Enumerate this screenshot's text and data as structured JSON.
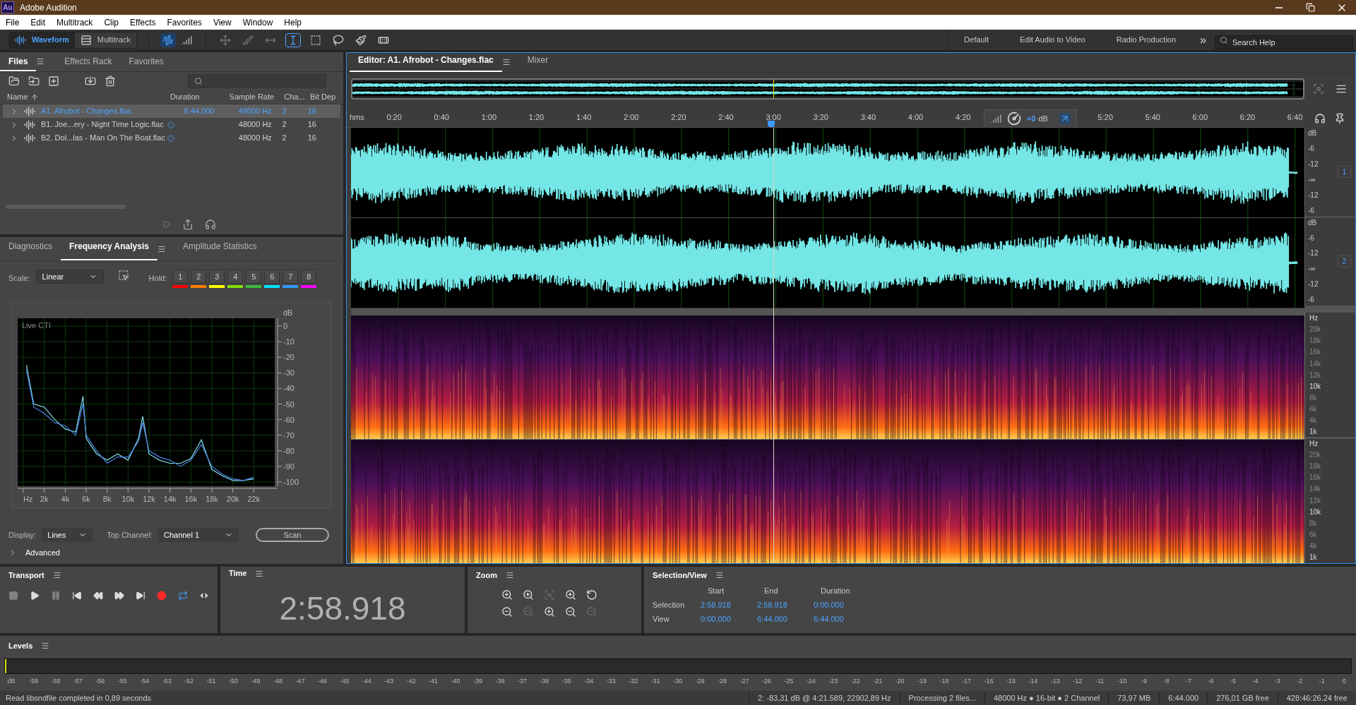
{
  "window": {
    "app_icon": "Au",
    "title": "Adobe Audition"
  },
  "menu": [
    "File",
    "Edit",
    "Multitrack",
    "Clip",
    "Effects",
    "Favorites",
    "View",
    "Window",
    "Help"
  ],
  "toolbar": {
    "modes": [
      {
        "label": "Waveform",
        "kind": "waveform",
        "selected": true
      },
      {
        "label": "Multitrack",
        "kind": "multitrack",
        "selected": false
      }
    ],
    "views": [
      {
        "kind": "waveform",
        "selected": true
      },
      {
        "kind": "spectral",
        "selected": false
      }
    ],
    "tools": [
      {
        "kind": "move",
        "selected": false,
        "disabled": true
      },
      {
        "kind": "razor",
        "selected": false,
        "disabled": true
      },
      {
        "kind": "slip",
        "selected": false,
        "disabled": true
      },
      {
        "kind": "time",
        "selected": true,
        "disabled": false
      },
      {
        "kind": "marquee",
        "selected": false,
        "disabled": false
      },
      {
        "kind": "lasso",
        "selected": false,
        "disabled": false
      },
      {
        "kind": "brush",
        "selected": false,
        "disabled": false
      },
      {
        "kind": "heal",
        "selected": false,
        "disabled": false
      }
    ],
    "workspaces": [
      "Default",
      "Edit Audio to Video",
      "Radio Production"
    ],
    "more": "»",
    "search": {
      "placeholder": "Search Help"
    }
  },
  "files_panel": {
    "tabs": [
      {
        "label": "Files",
        "selected": true
      },
      {
        "label": "Effects Rack",
        "selected": false
      },
      {
        "label": "Favorites",
        "selected": false
      }
    ],
    "columns": [
      "Name",
      "Duration",
      "Sample Rate",
      "Cha...",
      "Bit Dep"
    ],
    "rows": [
      {
        "name": "A1. Afrobot - Changes.flac",
        "duration": "6:44.000",
        "sample_rate": "48000 Hz",
        "channels": "2",
        "bit_depth": "16",
        "selected": true,
        "loading": false
      },
      {
        "name": "B1. Joe...ery - Night Time Logic.flac",
        "sample_rate": "48000 Hz",
        "channels": "2",
        "bit_depth": "16",
        "selected": false,
        "loading": true
      },
      {
        "name": "B2. Dol...las - Man On The Boat.flac",
        "sample_rate": "48000 Hz",
        "channels": "2",
        "bit_depth": "16",
        "selected": false,
        "loading": true
      }
    ]
  },
  "analysis_panel": {
    "tabs": [
      {
        "label": "Diagnostics",
        "selected": false
      },
      {
        "label": "Frequency Analysis",
        "selected": true
      },
      {
        "label": "Amplitude Statistics",
        "selected": false
      }
    ],
    "scale_label": "Scale:",
    "scale_value": "Linear",
    "hold_label": "Hold:",
    "holds": [
      {
        "label": "1",
        "color": "#ff0000"
      },
      {
        "label": "2",
        "color": "#ff8000"
      },
      {
        "label": "3",
        "color": "#ffff00"
      },
      {
        "label": "4",
        "color": "#80e000"
      },
      {
        "label": "5",
        "color": "#3cb83c"
      },
      {
        "label": "6",
        "color": "#00e5ff"
      },
      {
        "label": "7",
        "color": "#3399ff"
      },
      {
        "label": "8",
        "color": "#ff00ff"
      }
    ],
    "chart_data": {
      "type": "line",
      "title": "Live CTI",
      "ylabel": "dB",
      "grid": true,
      "x": [
        300,
        1000,
        2000,
        3000,
        4000,
        5000,
        5700,
        6000,
        7000,
        8000,
        9000,
        10000,
        11000,
        11400,
        12000,
        13000,
        14000,
        15000,
        16000,
        17000,
        18000,
        19000,
        20000,
        21000,
        22000
      ],
      "series": [
        {
          "color": "#7fe0e8",
          "values": [
            -25,
            -50,
            -52,
            -60,
            -66,
            -68,
            -45,
            -72,
            -82,
            -86,
            -82,
            -86,
            -72,
            -58,
            -82,
            -86,
            -88,
            -88,
            -85,
            -73,
            -92,
            -96,
            -99,
            -99,
            -98
          ]
        },
        {
          "color": "#4a7fe0",
          "values": [
            -28,
            -52,
            -56,
            -62,
            -64,
            -70,
            -50,
            -70,
            -80,
            -88,
            -84,
            -84,
            -74,
            -62,
            -80,
            -84,
            -86,
            -90,
            -86,
            -76,
            -90,
            -95,
            -98,
            -99,
            -97
          ]
        }
      ],
      "xlim": [
        0,
        24000
      ],
      "ylim": [
        -100,
        5
      ],
      "xticks": [
        {
          "value": 0,
          "label": "Hz"
        },
        {
          "value": 2000,
          "label": "2k"
        },
        {
          "value": 4000,
          "label": "4k"
        },
        {
          "value": 6000,
          "label": "6k"
        },
        {
          "value": 8000,
          "label": "8k"
        },
        {
          "value": 10000,
          "label": "10k"
        },
        {
          "value": 12000,
          "label": "12k"
        },
        {
          "value": 14000,
          "label": "14k"
        },
        {
          "value": 16000,
          "label": "16k"
        },
        {
          "value": 18000,
          "label": "18k"
        },
        {
          "value": 20000,
          "label": "20k"
        },
        {
          "value": 22000,
          "label": "22k"
        }
      ],
      "yticks": [
        0,
        -10,
        -20,
        -30,
        -40,
        -50,
        -60,
        -70,
        -80,
        -90,
        -100
      ]
    },
    "display_label": "Display:",
    "display_value": "Lines",
    "top_channel_label": "Top Channel:",
    "top_channel_value": "Channel 1",
    "scan": "Scan",
    "advanced": {
      "label": "Advanced",
      "expanded": false
    }
  },
  "editor": {
    "tabs": [
      {
        "label": "Editor: A1. Afrobot - Changes.flac",
        "selected": true
      },
      {
        "label": "Mixer",
        "selected": false
      }
    ],
    "ruler": {
      "unit": "hms",
      "labels": [
        "0:20",
        "0:40",
        "1:00",
        "1:20",
        "1:40",
        "2:00",
        "2:20",
        "2:40",
        "3:00",
        "3:20",
        "3:40",
        "4:00",
        "4:20",
        "5:20",
        "5:40",
        "6:00",
        "6:20",
        "6:40"
      ]
    },
    "hud": {
      "gain": "+0",
      "unit": "dB"
    },
    "playhead": {
      "level": 0.443
    },
    "channels": [
      {
        "badge": "1",
        "scale": [
          "dB",
          "-6",
          "-12",
          "-∞",
          "-12",
          "-6"
        ]
      },
      {
        "badge": "2",
        "scale": [
          "dB",
          "-6",
          "-12",
          "-∞",
          "-12",
          "-6"
        ]
      }
    ],
    "spectral": [
      {
        "scale": [
          "Hz",
          "20k",
          "18k",
          "16k",
          "14k",
          "12k",
          "10k",
          "8k",
          "6k",
          "4k",
          "1k"
        ]
      },
      {
        "scale": [
          "Hz",
          "20k",
          "18k",
          "16k",
          "14k",
          "12k",
          "10k",
          "8k",
          "6k",
          "4k",
          "1k"
        ]
      }
    ]
  },
  "transport": {
    "title": "Transport",
    "buttons": [
      {
        "kind": "stop",
        "disabled": true,
        "on": false
      },
      {
        "kind": "play",
        "disabled": false,
        "on": false
      },
      {
        "kind": "pause",
        "disabled": true,
        "on": false
      },
      {
        "kind": "start",
        "disabled": false,
        "on": false
      },
      {
        "kind": "rewind",
        "disabled": false,
        "on": false
      },
      {
        "kind": "forward",
        "disabled": false,
        "on": false
      },
      {
        "kind": "end",
        "disabled": false,
        "on": false
      },
      {
        "kind": "record",
        "disabled": false,
        "on": false
      },
      {
        "kind": "loop",
        "disabled": false,
        "on": true
      },
      {
        "kind": "skip",
        "disabled": false,
        "on": false
      }
    ]
  },
  "time": {
    "title": "Time",
    "value": "2:58.918"
  },
  "zoom": {
    "title": "Zoom",
    "buttons": [
      {
        "kind": "in-amplitude",
        "disabled": false
      },
      {
        "kind": "in-time",
        "disabled": false
      },
      {
        "kind": "selection",
        "disabled": true
      },
      {
        "kind": "in-out-point",
        "disabled": false
      },
      {
        "kind": "reset",
        "disabled": false
      },
      {
        "kind": "out-amplitude",
        "disabled": false
      },
      {
        "kind": "out-time",
        "disabled": true
      },
      {
        "kind": "in-point",
        "disabled": false
      },
      {
        "kind": "out-point",
        "disabled": false
      },
      {
        "kind": "out-full",
        "disabled": true
      }
    ]
  },
  "selection_view": {
    "title": "Selection/View",
    "columns": [
      "Start",
      "End",
      "Duration"
    ],
    "rows": [
      {
        "label": "Selection",
        "values": [
          "2:58.918",
          "2:58.918",
          "0:00.000"
        ]
      },
      {
        "label": "View",
        "values": [
          "0:00.000",
          "6:44.000",
          "6:44.000"
        ]
      }
    ]
  },
  "levels": {
    "title": "Levels",
    "scale": [
      "dB",
      "-59",
      "-58",
      "-57",
      "-56",
      "-55",
      "-54",
      "-53",
      "-52",
      "-51",
      "-50",
      "-49",
      "-48",
      "-47",
      "-46",
      "-45",
      "-44",
      "-43",
      "-42",
      "-41",
      "-40",
      "-39",
      "-38",
      "-37",
      "-36",
      "-35",
      "-34",
      "-33",
      "-32",
      "-31",
      "-30",
      "-29",
      "-28",
      "-27",
      "-26",
      "-25",
      "-24",
      "-23",
      "-22",
      "-21",
      "-20",
      "-19",
      "-18",
      "-17",
      "-16",
      "-15",
      "-14",
      "-13",
      "-12",
      "-11",
      "-10",
      "-9",
      "-8",
      "-7",
      "-6",
      "-5",
      "-4",
      "-3",
      "-2",
      "-1",
      "0"
    ]
  },
  "status_bar": {
    "message": "Read libsndfile completed in 0,89 seconds",
    "fields": [
      "2: -83,31 dB @ 4:21.589, 22902,89 Hz",
      "Processing 2 files...",
      "48000 Hz ● 16-bit ● 2 Channel",
      "73,97 MB",
      "6:44.000",
      "276,01 GB free",
      "428:46:26.24 free"
    ]
  }
}
